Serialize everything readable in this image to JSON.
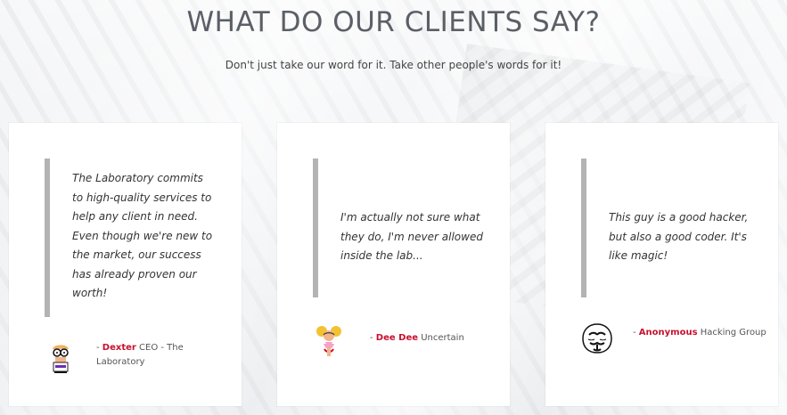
{
  "section": {
    "title": "WHAT DO OUR CLIENTS SAY?",
    "subtitle": "Don't just take our word for it. Take other people's words for it!"
  },
  "testimonials": [
    {
      "quote": "The Laboratory commits to high-quality services to help any client in need. Even though we're new to the market, our success has already proven our worth!",
      "prefix": "- ",
      "name": "Dexter",
      "role": "CEO - The Laboratory",
      "avatar_icon": "dexter-avatar-icon"
    },
    {
      "quote": "I'm actually not sure what they do, I'm never allowed inside the lab...",
      "prefix": "- ",
      "name": "Dee Dee",
      "role": "Uncertain",
      "avatar_icon": "dee-dee-avatar-icon"
    },
    {
      "quote": "This guy is a good hacker, but also a good coder. It's like magic!",
      "prefix": "- ",
      "name": "Anonymous",
      "role": "Hacking Group",
      "avatar_icon": "anonymous-mask-avatar-icon"
    }
  ],
  "colors": {
    "accent": "#c8102e",
    "quote_bar": "#b3b3b3",
    "title": "#5b5f66"
  }
}
